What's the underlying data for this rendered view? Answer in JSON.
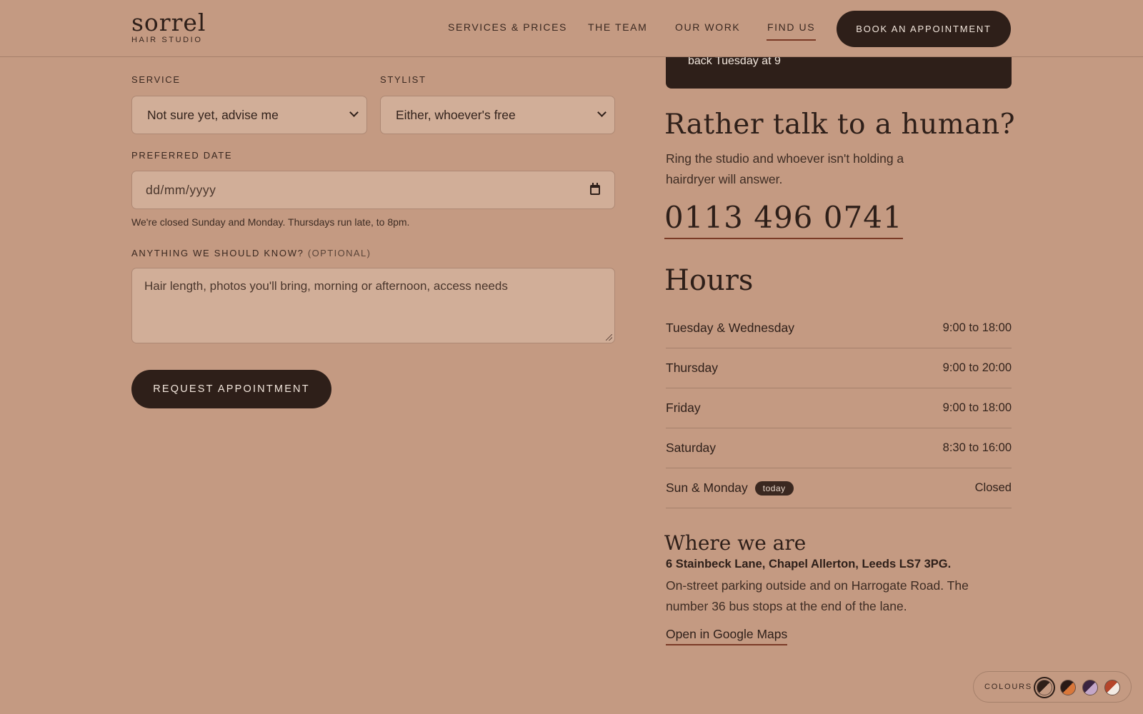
{
  "header": {
    "logo_name": "sorrel",
    "logo_sub": "HAIR STUDIO",
    "nav": [
      {
        "label": "SERVICES & PRICES"
      },
      {
        "label": "THE TEAM"
      },
      {
        "label": "OUR WORK"
      },
      {
        "label": "FIND US",
        "active": true
      }
    ],
    "book_label": "BOOK AN APPOINTMENT"
  },
  "form": {
    "service_label": "SERVICE",
    "service_value": "Not sure yet, advise me",
    "stylist_label": "STYLIST",
    "stylist_value": "Either, whoever's free",
    "date_label": "PREFERRED DATE",
    "date_placeholder": "dd/mm/yyyy",
    "date_hint": "We're closed Sunday and Monday. Thursdays run late, to 8pm.",
    "notes_label": "ANYTHING WE SHOULD KNOW?",
    "notes_optional": "(OPTIONAL)",
    "notes_placeholder": "Hair length, photos you'll bring, morning or afternoon, access needs",
    "submit_label": "REQUEST APPOINTMENT"
  },
  "status_card": {
    "text": "back Tuesday at 9"
  },
  "contact": {
    "heading": "Rather talk to a human?",
    "body": "Ring the studio and whoever isn't holding a hairdryer will answer.",
    "phone": "0113 496 0741"
  },
  "hours": {
    "heading": "Hours",
    "rows": [
      {
        "day": "Tuesday & Wednesday",
        "time": "9:00 to 18:00"
      },
      {
        "day": "Thursday",
        "time": "9:00 to 20:00"
      },
      {
        "day": "Friday",
        "time": "9:00 to 18:00"
      },
      {
        "day": "Saturday",
        "time": "8:30 to 16:00"
      },
      {
        "day": "Sun & Monday",
        "time": "Closed",
        "badge": "today"
      }
    ]
  },
  "location": {
    "heading": "Where we are",
    "address": "6 Stainbeck Lane, Chapel Allerton, Leeds LS7 3PG.",
    "body": "On-street parking outside and on Harrogate Road. The number 36 bus stops at the end of the lane.",
    "maps_link": "Open in Google Maps"
  },
  "colours": {
    "label": "COLOURS",
    "swatches": [
      {
        "a": "#2e1f19",
        "b": "#c49a82",
        "selected": true
      },
      {
        "a": "#2a1a16",
        "b": "#d9773a"
      },
      {
        "a": "#3a2440",
        "b": "#c4a7c8"
      },
      {
        "a": "#b5452a",
        "b": "#f3ebe4"
      }
    ]
  }
}
